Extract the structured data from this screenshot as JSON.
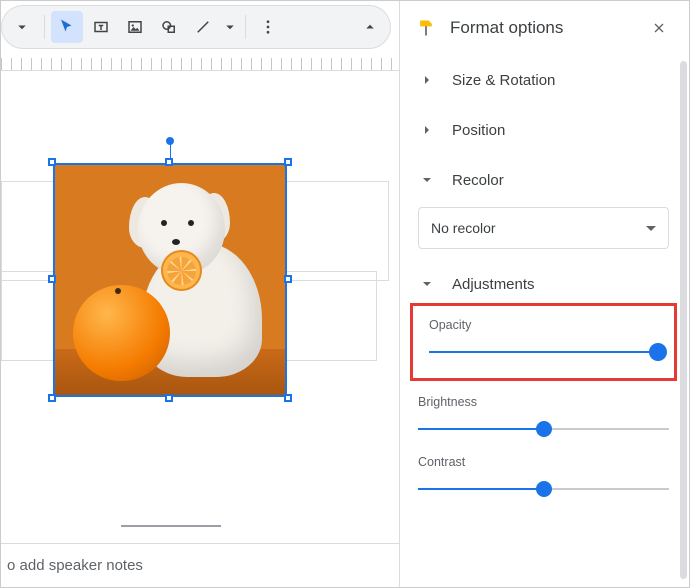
{
  "toolbar": {
    "tools": [
      "select",
      "textbox",
      "image",
      "shape",
      "line"
    ]
  },
  "panel": {
    "title": "Format options",
    "sections": {
      "size_rotation": "Size & Rotation",
      "position": "Position",
      "recolor": "Recolor",
      "adjustments": "Adjustments"
    },
    "recolor_dropdown": {
      "selected": "No recolor"
    },
    "sliders": {
      "opacity": {
        "label": "Opacity",
        "value": 100,
        "min": 0,
        "max": 100
      },
      "brightness": {
        "label": "Brightness",
        "value": 50,
        "min": 0,
        "max": 100
      },
      "contrast": {
        "label": "Contrast",
        "value": 50,
        "min": 0,
        "max": 100
      }
    }
  },
  "canvas": {
    "speaker_notes_placeholder": "o add speaker notes",
    "selected_image_description": "white fluffy dog with orange slice next to large orange on orange background"
  },
  "colors": {
    "accent": "#1a73e8",
    "highlight": "#e53935"
  }
}
